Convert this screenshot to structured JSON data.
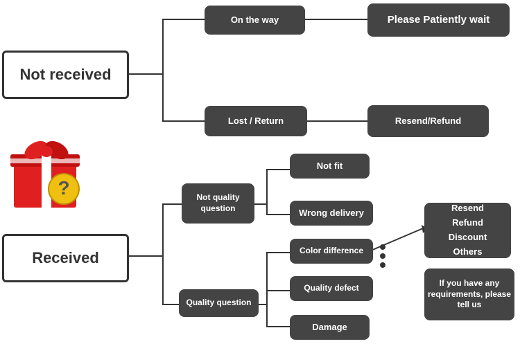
{
  "nodes": {
    "not_received": {
      "label": "Not received"
    },
    "on_the_way": {
      "label": "On the way"
    },
    "please_wait": {
      "label": "Please Patiently wait"
    },
    "lost_return": {
      "label": "Lost / Return"
    },
    "resend_refund_top": {
      "label": "Resend/Refund"
    },
    "received": {
      "label": "Received"
    },
    "not_quality": {
      "label": "Not quality\nquestion"
    },
    "quality_question": {
      "label": "Quality question"
    },
    "not_fit": {
      "label": "Not fit"
    },
    "wrong_delivery": {
      "label": "Wrong delivery"
    },
    "color_difference": {
      "label": "Color difference"
    },
    "quality_defect": {
      "label": "Quality defect"
    },
    "damage": {
      "label": "Damage"
    },
    "resend_etc": {
      "label": "Resend\nRefund\nDiscount\nOthers"
    },
    "requirements": {
      "label": "If you have any requirements, please tell us"
    }
  }
}
